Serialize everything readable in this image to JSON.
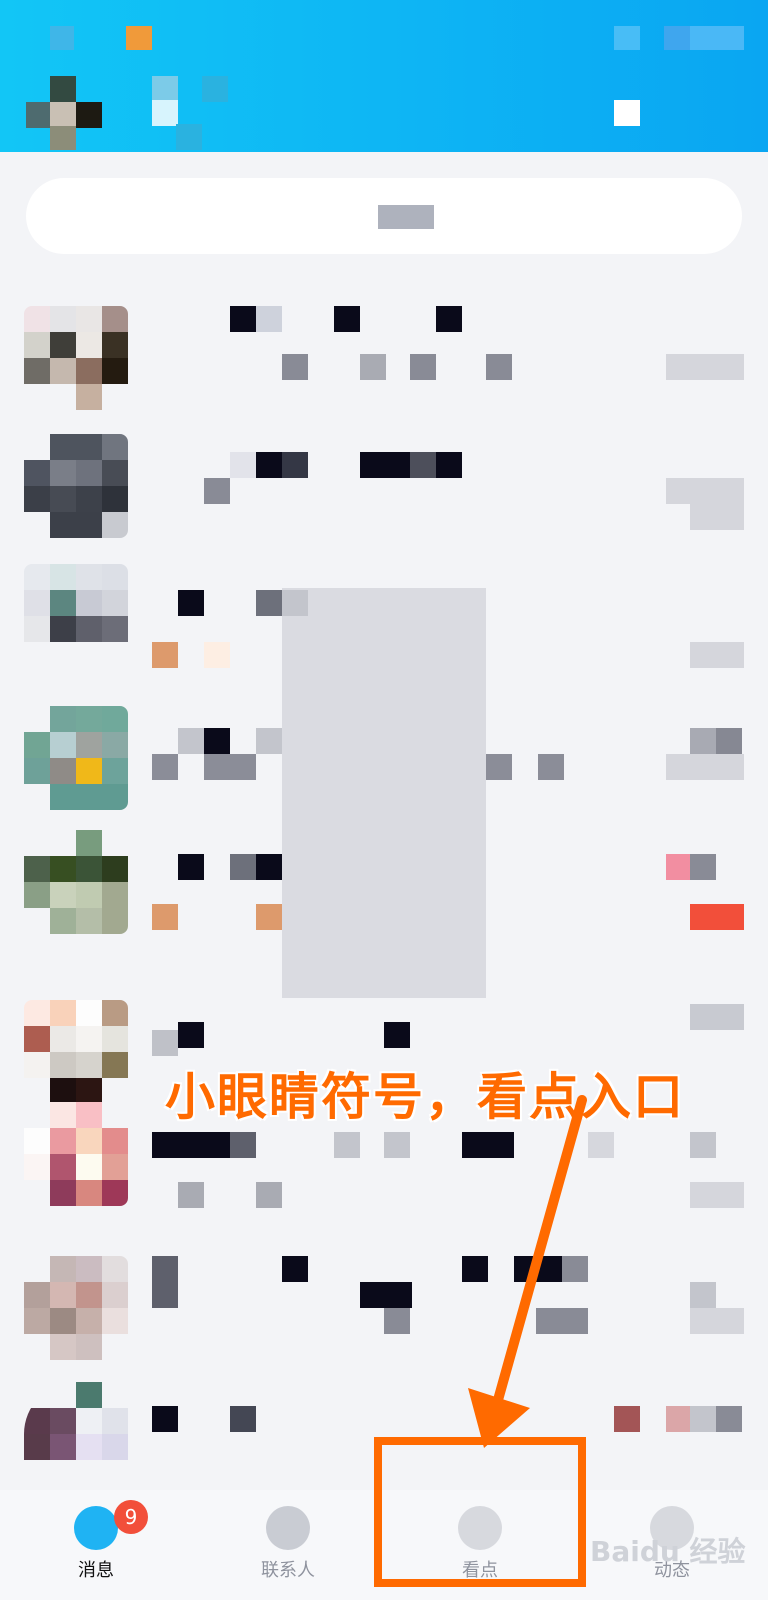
{
  "annotation": {
    "text": "小眼睛符号，看点入口"
  },
  "tabs": [
    {
      "label": "消息",
      "icon": "messages-icon",
      "badge": "9",
      "active": true
    },
    {
      "label": "联系人",
      "icon": "contacts-icon",
      "active": false
    },
    {
      "label": "看点",
      "icon": "eye-icon",
      "active": false
    },
    {
      "label": "动态",
      "icon": "star-icon",
      "active": false
    }
  ],
  "watermark": "Baidu 经验",
  "colors": {
    "header": "#0aa6f2",
    "annotation": "#ff6a00",
    "badge": "#f24f3a"
  }
}
